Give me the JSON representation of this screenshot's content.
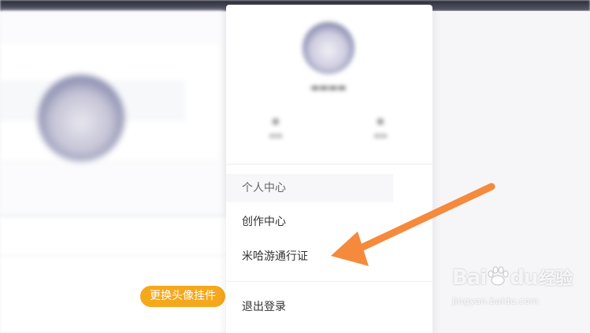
{
  "page": {
    "pendant_button_label": "更换头像挂件"
  },
  "dropdown": {
    "menu": [
      {
        "label": "个人中心"
      },
      {
        "label": "创作中心"
      },
      {
        "label": "米哈游通行证"
      },
      {
        "label": "退出登录"
      }
    ]
  },
  "watermark": {
    "logo_text": "Bai",
    "logo_text2": "du",
    "logo_cn": "经验",
    "url": "jingyan.baidu.com"
  },
  "annotation": {
    "arrow_color": "#f58a3c",
    "arrow_target": "米哈游通行证"
  },
  "colors": {
    "accent_orange": "#f5a81c",
    "arrow_orange": "#f58a3c"
  }
}
